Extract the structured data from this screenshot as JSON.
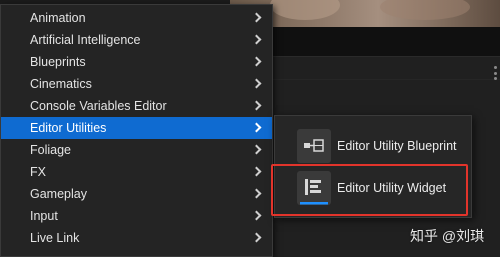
{
  "menu": {
    "items": [
      {
        "label": "Animation",
        "has_submenu": true
      },
      {
        "label": "Artificial Intelligence",
        "has_submenu": true
      },
      {
        "label": "Blueprints",
        "has_submenu": true
      },
      {
        "label": "Cinematics",
        "has_submenu": true
      },
      {
        "label": "Console Variables Editor",
        "has_submenu": true
      },
      {
        "label": "Editor Utilities",
        "has_submenu": true,
        "selected": true
      },
      {
        "label": "Foliage",
        "has_submenu": true
      },
      {
        "label": "FX",
        "has_submenu": true
      },
      {
        "label": "Gameplay",
        "has_submenu": true
      },
      {
        "label": "Input",
        "has_submenu": true
      },
      {
        "label": "Live Link",
        "has_submenu": true
      }
    ]
  },
  "submenu": {
    "items": [
      {
        "label": "Editor Utility Blueprint",
        "icon": "blueprint-icon"
      },
      {
        "label": "Editor Utility Widget",
        "icon": "widget-icon",
        "highlighted": true
      }
    ]
  },
  "watermark": {
    "text": "知乎 @刘琪"
  },
  "colors": {
    "menu_bg": "#242424",
    "selected_bg": "#0f6bd1",
    "highlight_border": "#e2342b",
    "widget_underline": "#1e90ff"
  }
}
